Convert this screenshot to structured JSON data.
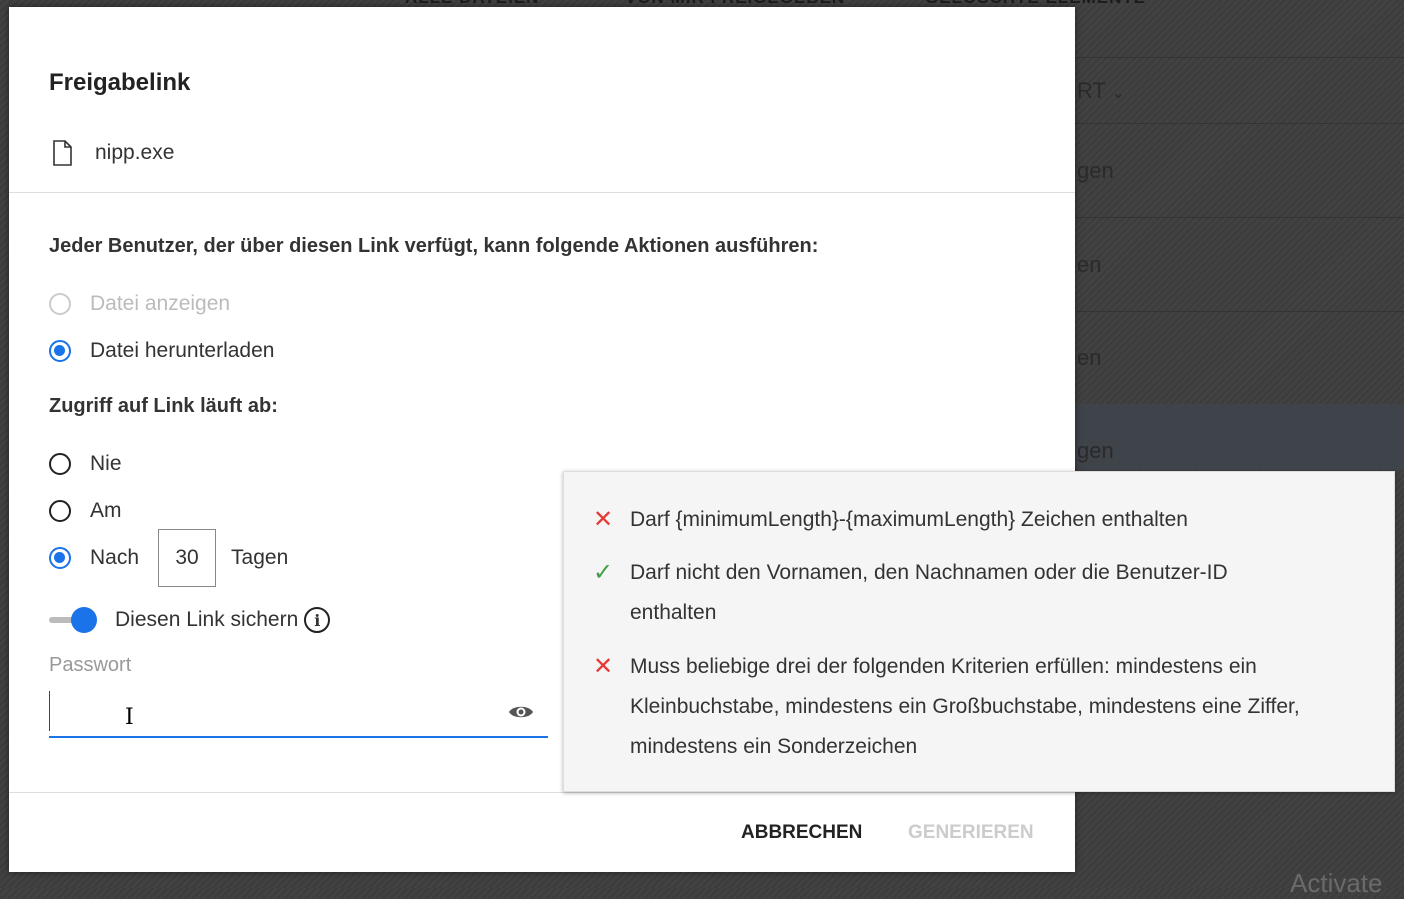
{
  "background": {
    "tabs": [
      "ALLE DATEIEN",
      "VON MIR FREIGEGEBEN",
      "GELÖSCHTE ELEMENTE"
    ],
    "fragments": [
      "RT",
      "gen",
      "en",
      "en",
      "gen"
    ],
    "watermark": "Activate"
  },
  "dialog": {
    "title": "Freigabelink",
    "file_name": "nipp.exe",
    "permission_heading": "Jeder Benutzer, der über diesen Link verfügt, kann folgende Aktionen ausführen:",
    "permissions": [
      {
        "label": "Datei anzeigen",
        "selected": false,
        "disabled": true
      },
      {
        "label": "Datei herunterladen",
        "selected": true,
        "disabled": false
      }
    ],
    "expiry_heading": "Zugriff auf Link läuft ab:",
    "expiry_options": [
      {
        "label": "Nie",
        "selected": false
      },
      {
        "label": "Am",
        "selected": false
      },
      {
        "label": "Nach",
        "selected": true
      }
    ],
    "days_value": "30",
    "days_unit": "Tagen",
    "secure_label": "Diesen Link sichern",
    "secure_enabled": true,
    "password_label": "Passwort",
    "password_value": "",
    "cancel_label": "ABBRECHEN",
    "generate_label": "GENERIEREN"
  },
  "password_rules": [
    {
      "status": "fail",
      "text": "Darf {minimumLength}-{maximumLength} Zeichen enthalten"
    },
    {
      "status": "pass",
      "text": "Darf nicht den Vornamen, den Nachnamen oder die Benutzer-ID enthalten"
    },
    {
      "status": "fail",
      "text": "Muss beliebige drei der folgenden Kriterien erfüllen: mindestens ein Kleinbuchstabe, mindestens ein Großbuchstabe, mindestens eine Ziffer, mindestens ein Sonderzeichen"
    }
  ],
  "colors": {
    "accent": "#1a73e8",
    "fail": "#e53935",
    "pass": "#43a047"
  }
}
